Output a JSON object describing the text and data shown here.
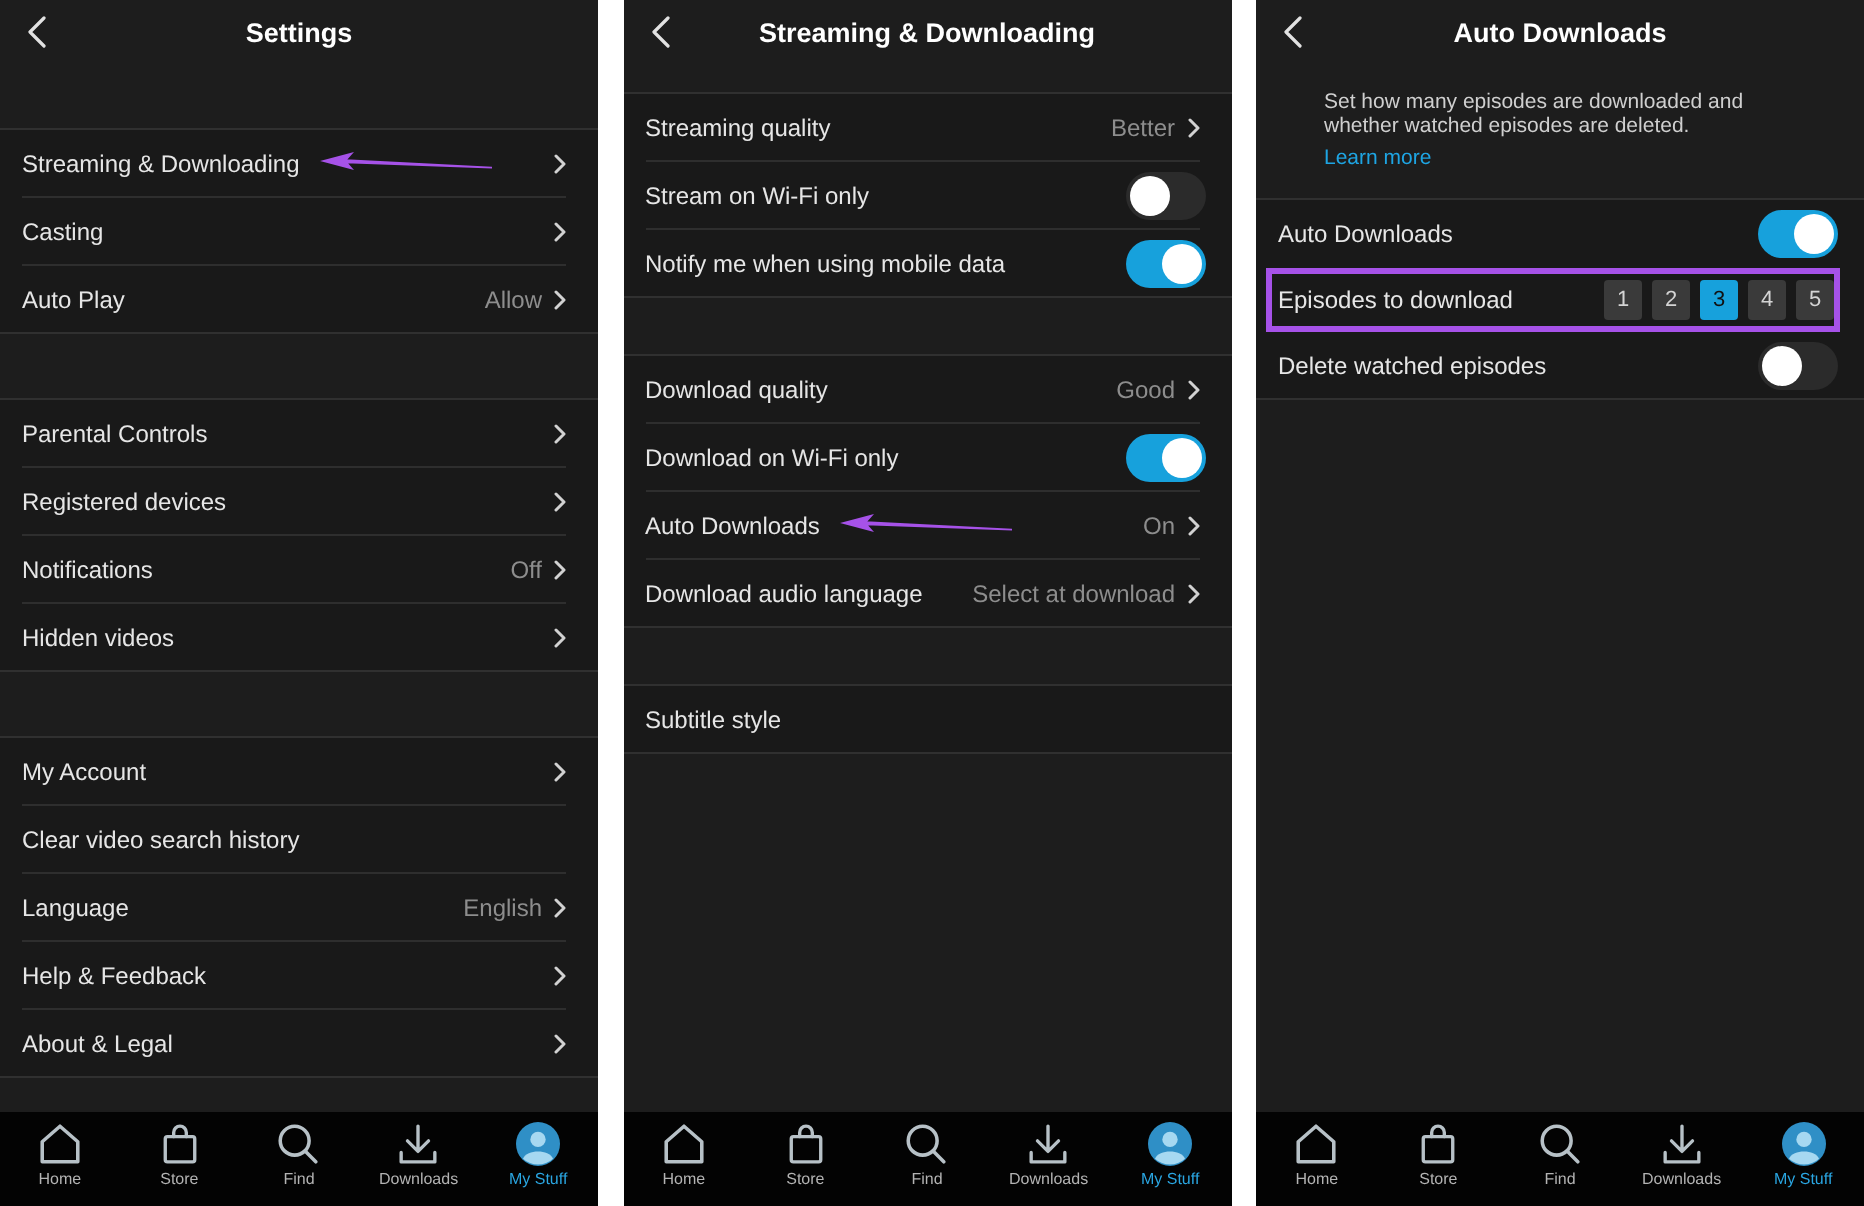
{
  "screens": [
    {
      "title": "Settings",
      "sections": [
        {
          "rows": [
            {
              "kind": "link",
              "label": "Streaming & Downloading",
              "annotation": {
                "kind": "arrow"
              }
            },
            {
              "kind": "link",
              "label": "Casting"
            },
            {
              "kind": "link",
              "label": "Auto Play",
              "value": "Allow"
            }
          ]
        },
        {
          "rows": [
            {
              "kind": "link",
              "label": "Parental Controls"
            },
            {
              "kind": "link",
              "label": "Registered devices"
            },
            {
              "kind": "link",
              "label": "Notifications",
              "value": "Off"
            },
            {
              "kind": "link",
              "label": "Hidden videos"
            }
          ]
        },
        {
          "rows": [
            {
              "kind": "link",
              "label": "My Account"
            },
            {
              "kind": "action",
              "label": "Clear video search history"
            },
            {
              "kind": "link",
              "label": "Language",
              "value": "English"
            },
            {
              "kind": "link",
              "label": "Help & Feedback"
            },
            {
              "kind": "link",
              "label": "About & Legal"
            }
          ]
        }
      ],
      "tab_bar": [
        {
          "label": "Home",
          "selected": false
        },
        {
          "label": "Store",
          "selected": false
        },
        {
          "label": "Find",
          "selected": false
        },
        {
          "label": "Downloads",
          "selected": false
        },
        {
          "label": "My Stuff",
          "selected": true
        }
      ]
    },
    {
      "title": "Streaming & Downloading",
      "sections": [
        {
          "rows": [
            {
              "kind": "link",
              "label": "Streaming quality",
              "value": "Better"
            },
            {
              "kind": "toggle",
              "label": "Stream on Wi-Fi only",
              "on": false
            },
            {
              "kind": "toggle",
              "label": "Notify me when using mobile data",
              "on": true
            }
          ]
        },
        {
          "rows": [
            {
              "kind": "link",
              "label": "Download quality",
              "value": "Good"
            },
            {
              "kind": "toggle",
              "label": "Download on Wi-Fi only",
              "on": true
            },
            {
              "kind": "link",
              "label": "Auto Downloads",
              "value": "On",
              "annotation": {
                "kind": "arrow"
              }
            },
            {
              "kind": "link",
              "label": "Download audio language",
              "value": "Select at download"
            }
          ]
        },
        {
          "rows": [
            {
              "kind": "action",
              "label": "Subtitle style"
            }
          ]
        }
      ],
      "tab_bar": [
        {
          "label": "Home",
          "selected": false
        },
        {
          "label": "Store",
          "selected": false
        },
        {
          "label": "Find",
          "selected": false
        },
        {
          "label": "Downloads",
          "selected": false
        },
        {
          "label": "My Stuff",
          "selected": true
        }
      ]
    },
    {
      "title": "Auto Downloads",
      "description": {
        "text": "Set how many episodes are downloaded and whether watched episodes are deleted.",
        "link": "Learn more"
      },
      "sections": [
        {
          "rows": [
            {
              "kind": "toggle",
              "label": "Auto Downloads",
              "on": true
            },
            {
              "kind": "choice",
              "label": "Episodes to download",
              "annotation": {
                "kind": "frame"
              },
              "options": [
                {
                  "label": "1",
                  "selected": false
                },
                {
                  "label": "2",
                  "selected": false
                },
                {
                  "label": "3",
                  "selected": true
                },
                {
                  "label": "4",
                  "selected": false
                },
                {
                  "label": "5",
                  "selected": false
                }
              ]
            },
            {
              "kind": "toggle",
              "label": "Delete watched episodes",
              "on": false
            }
          ]
        }
      ],
      "tab_bar": [
        {
          "label": "Home",
          "selected": false
        },
        {
          "label": "Store",
          "selected": false
        },
        {
          "label": "Find",
          "selected": false
        },
        {
          "label": "Downloads",
          "selected": false
        },
        {
          "label": "My Stuff",
          "selected": true
        }
      ]
    }
  ]
}
